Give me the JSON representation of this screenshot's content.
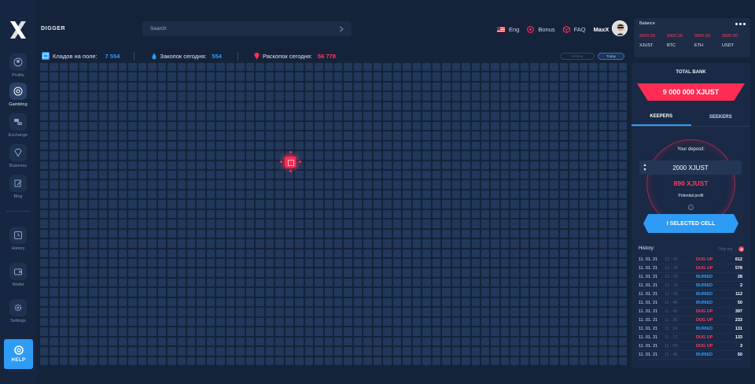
{
  "app": {
    "title": "DIGGER"
  },
  "sidebar": {
    "items": [
      {
        "label": "Profile",
        "icon": "user-icon"
      },
      {
        "label": "Gambling",
        "icon": "chip-icon"
      },
      {
        "label": "Exchange",
        "icon": "exchange-icon"
      },
      {
        "label": "Business",
        "icon": "diamond-icon"
      },
      {
        "label": "Blog",
        "icon": "pen-icon"
      },
      {
        "label": "History",
        "icon": "clock-icon"
      },
      {
        "label": "Wallet",
        "icon": "wallet-icon"
      },
      {
        "label": "Settings",
        "icon": "gear-icon"
      }
    ],
    "help_label": "HELP"
  },
  "search": {
    "placeholder": "Search"
  },
  "header": {
    "language": "Eng",
    "bonus": "Bonus",
    "faq": "FAQ",
    "user": "MaxX"
  },
  "stats": {
    "treasures_label": "Кладов на поле:",
    "treasures_value": "7 554",
    "buried_label": "Закопок сегодня:",
    "buried_value": "554",
    "dug_label": "Раскопок сегодня:",
    "dug_value": "56 778"
  },
  "filters": {
    "all_time": "All time",
    "today": "Today"
  },
  "balance": {
    "title": "Balance",
    "items": [
      {
        "value": "9900.00",
        "currency": "XJUST"
      },
      {
        "value": "9900.00",
        "currency": "BTC"
      },
      {
        "value": "9900.00",
        "currency": "ETH"
      },
      {
        "value": "9900.00",
        "currency": "USDT"
      }
    ]
  },
  "bank": {
    "title": "TOTAL BANK",
    "value": "9 000 000 XJUST"
  },
  "tabs": {
    "keepers": "KEEPERS",
    "seekers": "SEEKERS"
  },
  "deposit": {
    "label": "Your deposit:",
    "value": "2000 XJUST",
    "profit_value": "890 XJUST",
    "profit_label": "Potential profit",
    "button": "I SELECTED CELL"
  },
  "history": {
    "title": "History:",
    "only_my": "Only my",
    "rows": [
      {
        "date": "11. 01. 21",
        "time": "12 : 41",
        "status": "DUG UP",
        "amount": "612"
      },
      {
        "date": "11. 01. 21",
        "time": "12 : 39",
        "status": "DUG UP",
        "amount": "578"
      },
      {
        "date": "11. 01. 21",
        "time": "12 : 20",
        "status": "BURIED",
        "amount": "28"
      },
      {
        "date": "11. 01. 21",
        "time": "12 : 12",
        "status": "BURIED",
        "amount": "2"
      },
      {
        "date": "11. 01. 21",
        "time": "12 : 06",
        "status": "BURIED",
        "amount": "112"
      },
      {
        "date": "11. 01. 21",
        "time": "11 : 48",
        "status": "BURIED",
        "amount": "50"
      },
      {
        "date": "11. 01. 21",
        "time": "11 : 42",
        "status": "DUG UP",
        "amount": "397"
      },
      {
        "date": "11. 01. 21",
        "time": "11 : 36",
        "status": "DUG UP",
        "amount": "233"
      },
      {
        "date": "11. 01. 21",
        "time": "11 : 24",
        "status": "BURIED",
        "amount": "131"
      },
      {
        "date": "11. 01. 21",
        "time": "11 : 12",
        "status": "DUG UP",
        "amount": "133"
      },
      {
        "date": "11. 01. 21",
        "time": "11 : 08",
        "status": "DUG UP",
        "amount": "3"
      },
      {
        "date": "11. 01. 21",
        "time": "11 : 48",
        "status": "BURIED",
        "amount": "50"
      }
    ]
  },
  "colors": {
    "accent_red": "#ff2d54",
    "accent_blue": "#2e9cf5",
    "background": "#15233a",
    "cell": "#21385a"
  }
}
